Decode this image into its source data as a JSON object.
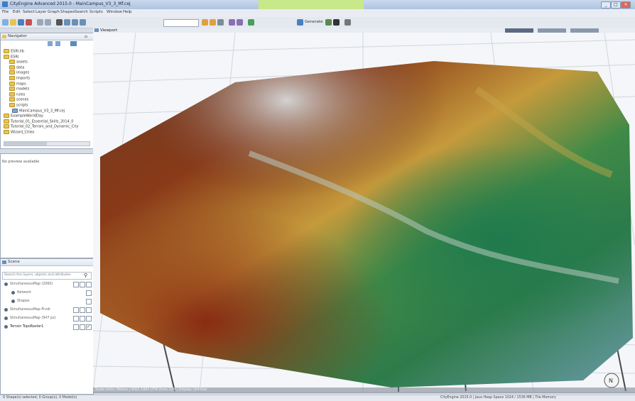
{
  "window": {
    "title": "CityEngine Advanced 2015.0 - MainCampus_V3_3_Mf.cej",
    "min": "_",
    "max": "□",
    "close": "×"
  },
  "menu": [
    "File",
    "Edit",
    "Select",
    "Layer",
    "Graph",
    "Shapes",
    "Search",
    "Scripts",
    "Window",
    "Help"
  ],
  "toolbar": {
    "generate_label": "Generate"
  },
  "navigator": {
    "title": "Navigator",
    "tree": [
      {
        "label": "ESRI.lib",
        "indent": 0,
        "folder": true
      },
      {
        "label": "ESRI",
        "indent": 0,
        "folder": true
      },
      {
        "label": "assets",
        "indent": 2,
        "folder": true
      },
      {
        "label": "data",
        "indent": 2,
        "folder": true
      },
      {
        "label": "images",
        "indent": 2,
        "folder": true
      },
      {
        "label": "imports",
        "indent": 2,
        "folder": true
      },
      {
        "label": "maps",
        "indent": 2,
        "folder": true
      },
      {
        "label": "models",
        "indent": 2,
        "folder": true
      },
      {
        "label": "rules",
        "indent": 2,
        "folder": true
      },
      {
        "label": "scenes",
        "indent": 2,
        "folder": true
      },
      {
        "label": "scripts",
        "indent": 2,
        "folder": true
      },
      {
        "label": "MainCampus_V3_3_Mf.cej",
        "indent": 3,
        "folder": false
      },
      {
        "label": "ExampleWorldDay",
        "indent": 0,
        "folder": true
      },
      {
        "label": "Tutorial_01_Essential_Skills_2014_0",
        "indent": 0,
        "folder": true
      },
      {
        "label": "Tutorial_02_Terrain_and_Dynamic_City",
        "indent": 0,
        "folder": true
      },
      {
        "label": "Wizard_Cities",
        "indent": 0,
        "folder": true
      }
    ]
  },
  "preview": {
    "text": "No preview available"
  },
  "scene": {
    "title": "Scene",
    "search_placeholder": "Search the layers, objects and attributes",
    "layers": [
      {
        "label": "SimultaneousMap (2060)",
        "indent": 0,
        "checks": 3,
        "checked": false
      },
      {
        "label": "Network",
        "indent": 2,
        "checks": 1,
        "checked": false
      },
      {
        "label": "Shapes",
        "indent": 2,
        "checks": 1,
        "checked": false
      },
      {
        "label": "SimultaneousMap Prvdr",
        "indent": 0,
        "checks": 3,
        "checked": false
      },
      {
        "label": "SimultaneousMap (947 px)",
        "indent": 0,
        "checks": 3,
        "checked": false
      },
      {
        "label": "Terrain TopoRaster1",
        "indent": 0,
        "checks": 3,
        "checked": true
      }
    ]
  },
  "viewport": {
    "title": "Viewport",
    "statusline": "Scale Units: Meters  |  WGS 1984 UTM Zone 12N  |  Display: Untitled",
    "compass": "N"
  },
  "statusbar": {
    "left": "0 Shape(s) selected, 0 Group(s), 0 Model(s)",
    "right": "CityEngine 2015.0 | Java Heap Space 1024 / 1536 MB | Tile Memory"
  },
  "colors": {
    "terrain_low": "#2f8e4a",
    "terrain_mid": "#c6a640",
    "terrain_high": "#5a2410",
    "snow": "#cfcfcf",
    "accent": "#c9e88a"
  }
}
